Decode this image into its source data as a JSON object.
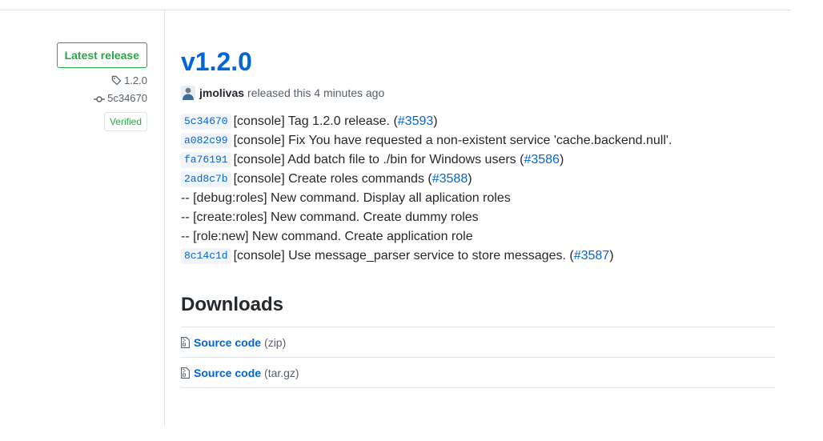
{
  "sidebar": {
    "latest_label": "Latest release",
    "tag": "1.2.0",
    "commit": "5c34670",
    "verified_label": "Verified",
    "tag_icon": "tag-icon",
    "commit_icon": "commit-icon"
  },
  "release": {
    "title": "v1.2.0",
    "author": "jmolivas",
    "released_text": "released this 4 minutes ago",
    "notes": [
      {
        "sha": "5c34670",
        "text": "[console] Tag 1.2.0 release. (",
        "link": "#3593",
        "tail": ")"
      },
      {
        "sha": "a082c99",
        "text": "[console] Fix You have requested a non-existent service 'cache.backend.null'.",
        "link": "",
        "tail": ""
      },
      {
        "sha": "fa76191",
        "text": "[console] Add batch file to ./bin for Windows users (",
        "link": "#3586",
        "tail": ")"
      },
      {
        "sha": "2ad8c7b",
        "text": "[console] Create roles commands (",
        "link": "#3588",
        "tail": ")"
      },
      {
        "sha": "",
        "text": "-- [debug:roles] New command. Display all aplication roles",
        "link": "",
        "tail": ""
      },
      {
        "sha": "",
        "text": "-- [create:roles] New command. Create dummy roles",
        "link": "",
        "tail": ""
      },
      {
        "sha": "",
        "text": "-- [role:new] New command. Create application role",
        "link": "",
        "tail": ""
      },
      {
        "sha": "8c14c1d",
        "text": "[console] Use message_parser service to store messages. (",
        "link": "#3587",
        "tail": ")"
      }
    ]
  },
  "downloads": {
    "title": "Downloads",
    "items": [
      {
        "name": "Source code",
        "ext": "(zip)",
        "icon": "file-zip-icon"
      },
      {
        "name": "Source code",
        "ext": "(tar.gz)",
        "icon": "file-zip-icon"
      }
    ]
  },
  "colors": {
    "link": "#0366d6",
    "verified": "#28a745",
    "border": "#e1e4e8",
    "muted": "#586069"
  }
}
